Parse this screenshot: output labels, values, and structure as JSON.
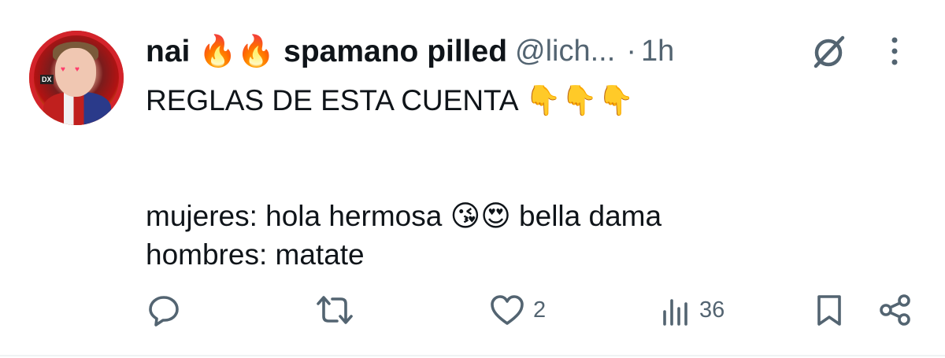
{
  "tweet": {
    "display_name": "nai 🔥🔥 spamano pilled",
    "handle": "@lich...",
    "separator": "·",
    "timestamp": "1h",
    "lines": [
      "REGLAS DE ESTA CUENTA 👇👇👇",
      "",
      "",
      "mujeres: hola hermosa 😘😍 bella dama",
      "hombres: matate"
    ]
  },
  "avatar": {
    "sponsor_text": "DX",
    "hearts": "♥♥"
  },
  "actions": {
    "reply_count": "",
    "repost_count": "",
    "like_count": "2",
    "views_count": "36"
  },
  "icons": {
    "reply": "reply-icon",
    "repost": "repost-icon",
    "like": "like-icon",
    "views": "views-icon",
    "bookmark": "bookmark-icon",
    "share": "share-icon",
    "grok": "grok-icon",
    "more": "more-icon"
  },
  "colors": {
    "text": "#0f1419",
    "secondary": "#536471",
    "divider": "#eff3f4"
  }
}
